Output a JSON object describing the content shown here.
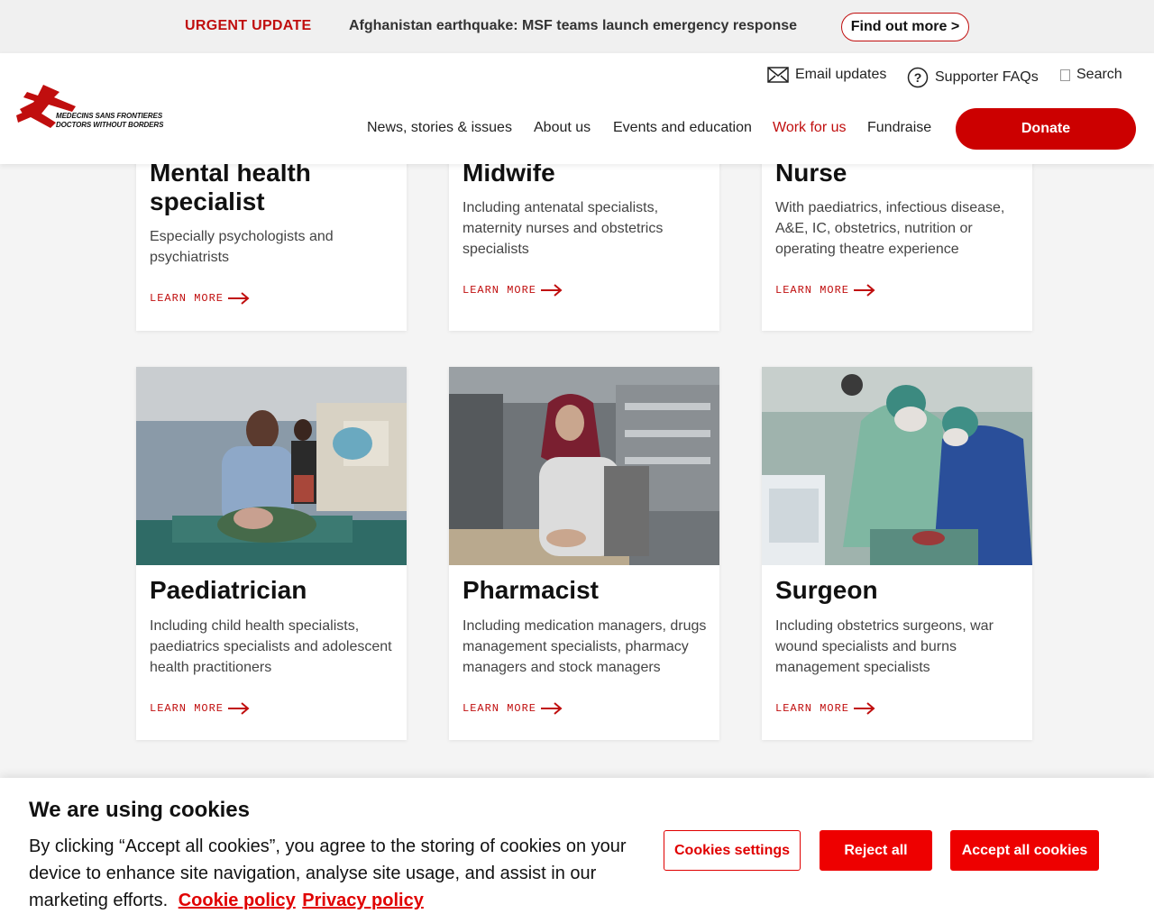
{
  "urgent": {
    "tag": "URGENT UPDATE",
    "message": "Afghanistan earthquake: MSF teams launch emergency response",
    "button": "Find out more >"
  },
  "header": {
    "logo_line1": "MEDECINS SANS FRONTIERES",
    "logo_line2": "DOCTORS WITHOUT BORDERS",
    "brand_color": "#cc0000",
    "util": {
      "email": "Email updates",
      "faq": "Supporter FAQs",
      "search": "Search"
    },
    "nav": [
      "News, stories & issues",
      "About us",
      "Events and education",
      "Work for us",
      "Fundraise"
    ],
    "active_nav": "Work for us",
    "donate": "Donate"
  },
  "cards": [
    {
      "title": "Mental health specialist",
      "desc": "Especially psychologists and psychiatrists",
      "link": "LEARN MORE"
    },
    {
      "title": "Midwife",
      "desc": "Including antenatal specialists, maternity nurses and obstetrics specialists",
      "link": "LEARN MORE"
    },
    {
      "title": "Nurse",
      "desc": "With paediatrics, infectious disease, A&E, IC, obstetrics, nutrition or operating theatre experience",
      "link": "LEARN MORE"
    },
    {
      "title": "Paediatrician",
      "desc": "Including child health specialists, paediatrics specialists and adolescent health practitioners",
      "link": "LEARN MORE"
    },
    {
      "title": "Pharmacist",
      "desc": "Including medication managers, drugs management specialists, pharmacy managers and stock managers",
      "link": "LEARN MORE"
    },
    {
      "title": "Surgeon",
      "desc": "Including obstetrics surgeons, war wound specialists and burns management specialists",
      "link": "LEARN MORE"
    }
  ],
  "cookie": {
    "title": "We are using cookies",
    "body": "By clicking “Accept all cookies”, you agree to the storing of cookies on your device to enhance site navigation, analyse site usage, and assist in our marketing efforts.",
    "cookie_policy": "Cookie policy",
    "privacy_policy": "Privacy policy",
    "settings": "Cookies settings",
    "reject": "Reject all",
    "accept": "Accept all cookies"
  }
}
